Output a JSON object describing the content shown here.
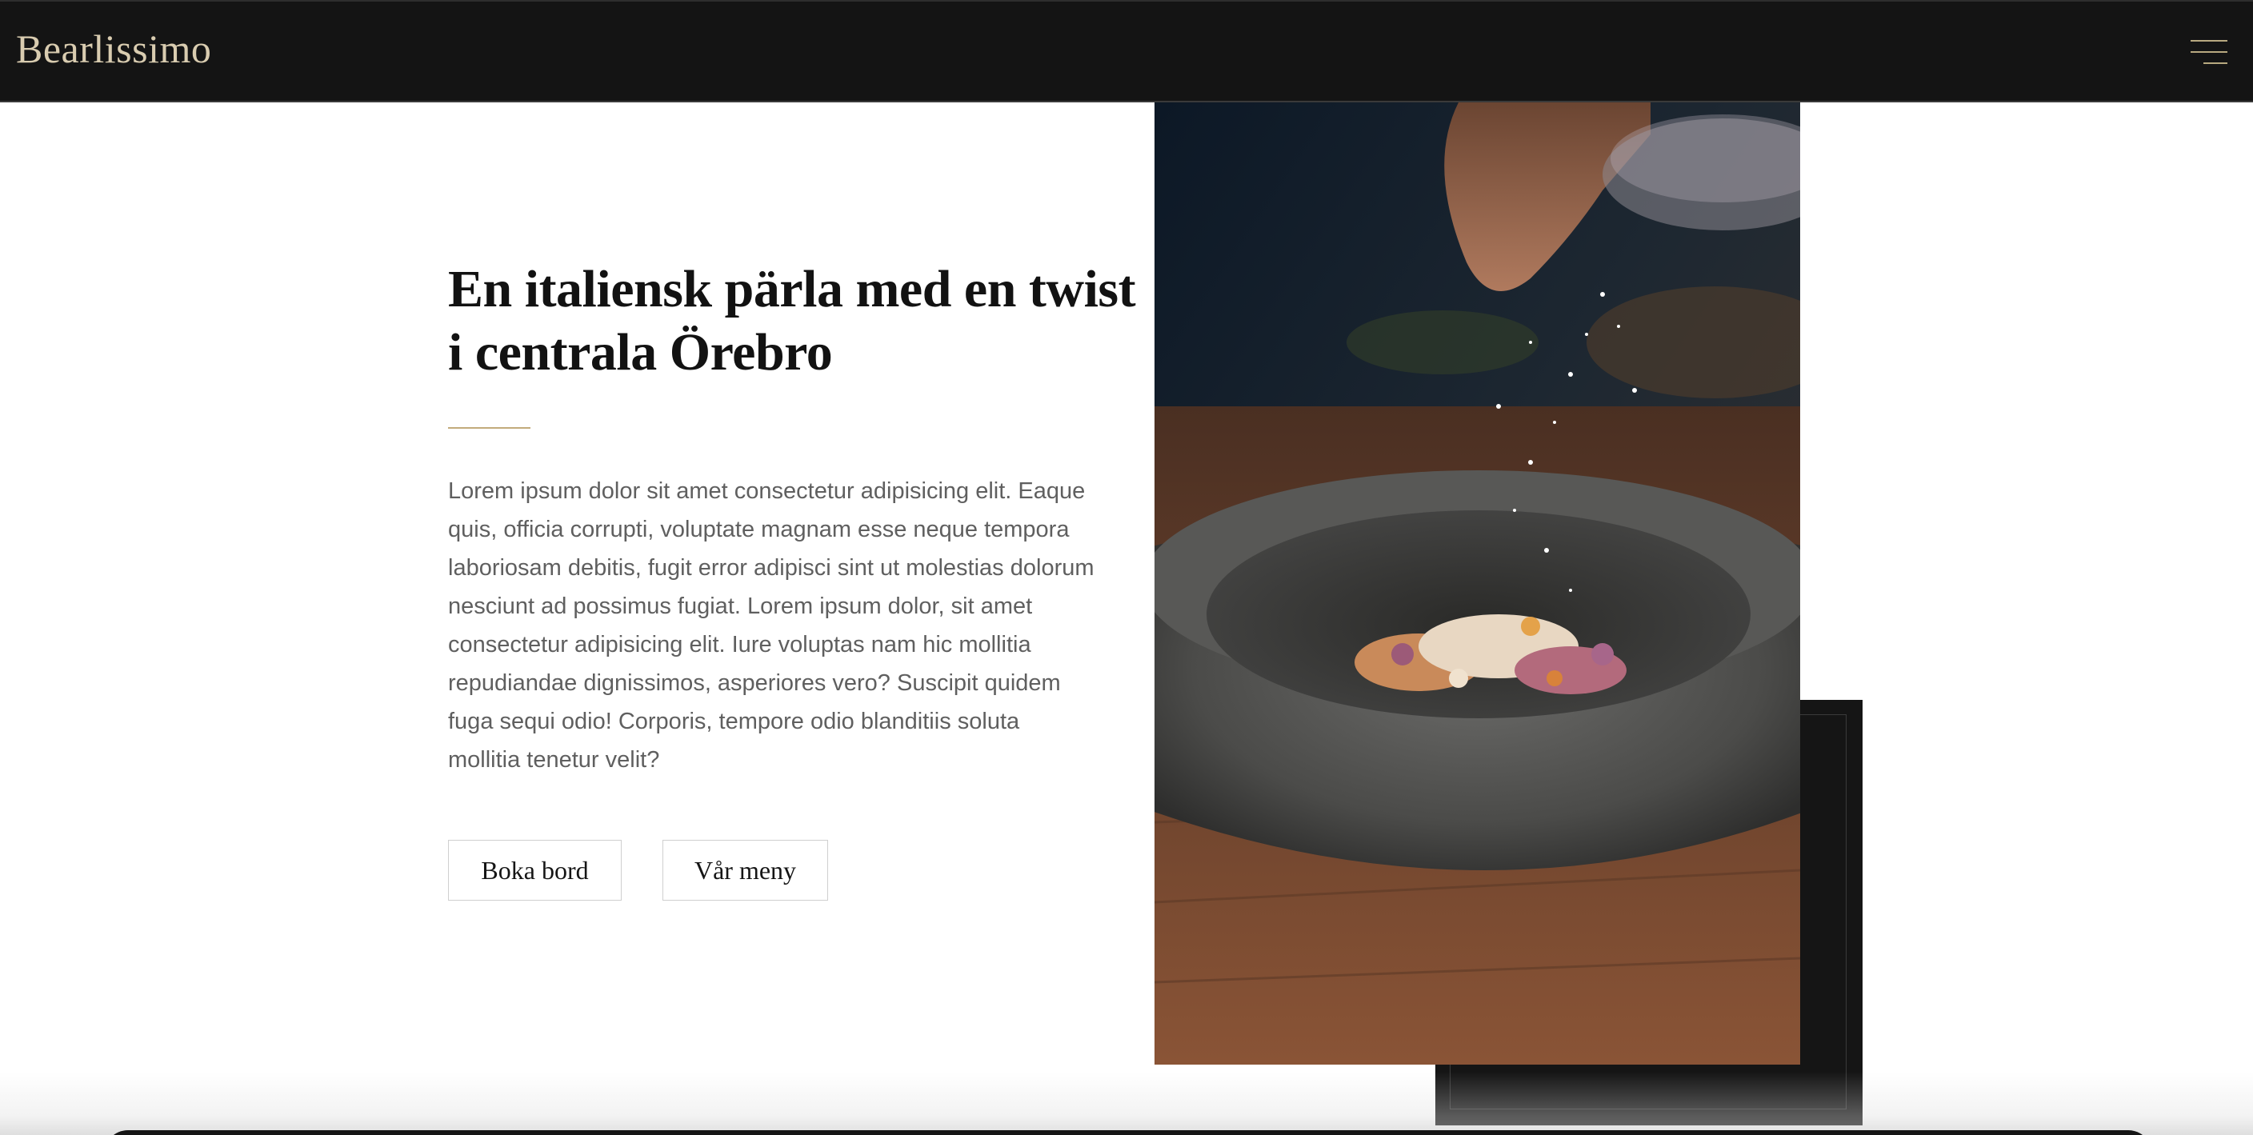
{
  "header": {
    "logo_text": "Bearlissimo",
    "menu_icon": "hamburger-menu-icon"
  },
  "hero": {
    "headline": "En italiensk pärla med en twist i centrala Örebro",
    "body": "Lorem ipsum dolor sit amet consectetur adipisicing elit. Eaque quis, officia corrupti, voluptate magnam esse neque tempora laboriosam debitis, fugit error adipisci sint ut molestias dolorum nesciunt ad possimus fugiat. Lorem ipsum dolor, sit amet consectetur adipisicing elit. Iure voluptas nam hic mollitia repudiandae dignissimos, asperiores vero? Suscipit quidem fuga sequi odio! Corporis, tempore odio blanditiis soluta mollitia tenetur velit?",
    "buttons": {
      "book_label": "Boka bord",
      "menu_label": "Vår meny"
    }
  },
  "colors": {
    "header_bg": "#141414",
    "logo": "#d9ccb0",
    "accent_gold": "#c2ab7b",
    "headline": "#121212",
    "body_text": "#5f5f5f"
  }
}
